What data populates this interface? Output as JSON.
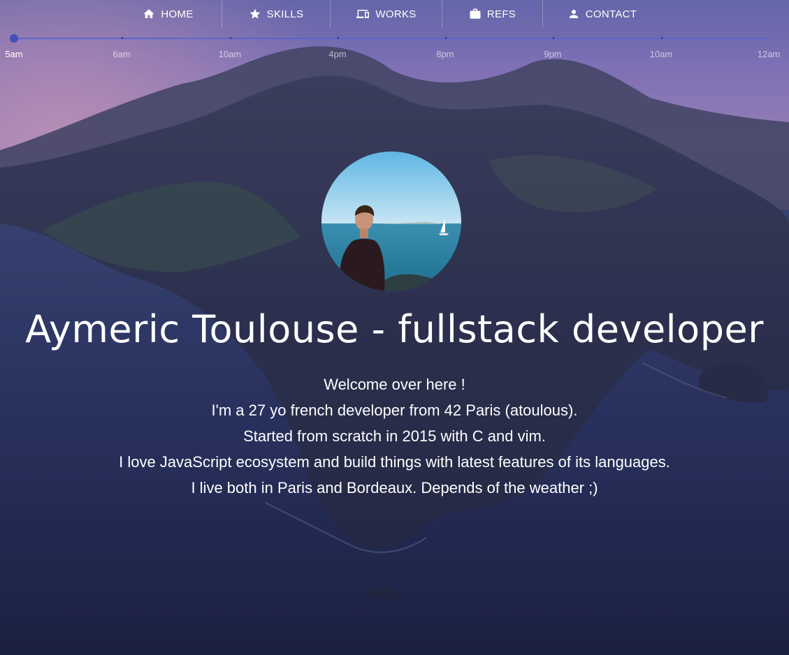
{
  "nav": {
    "items": [
      {
        "label": "HOME",
        "icon": "home-icon"
      },
      {
        "label": "SKILLS",
        "icon": "star-icon"
      },
      {
        "label": "WORKS",
        "icon": "devices-icon"
      },
      {
        "label": "REFS",
        "icon": "briefcase-icon"
      },
      {
        "label": "CONTACT",
        "icon": "person-icon"
      }
    ]
  },
  "timeline": {
    "labels": [
      "5am",
      "6am",
      "10am",
      "4pm",
      "8pm",
      "9pm",
      "10am",
      "12am"
    ],
    "active": "5am",
    "accent": "#3f51b5"
  },
  "hero": {
    "title": "Aymeric Toulouse - fullstack developer",
    "avatar": "profile-photo",
    "lines": [
      "Welcome over here !",
      "I'm a 27 yo french developer from 42 Paris (atoulous).",
      "Started from scratch in 2015 with C and vim.",
      "I love JavaScript ecosystem and build things with latest features of its languages.",
      "I live both in Paris and Bordeaux. Depends of the weather ;)"
    ]
  }
}
